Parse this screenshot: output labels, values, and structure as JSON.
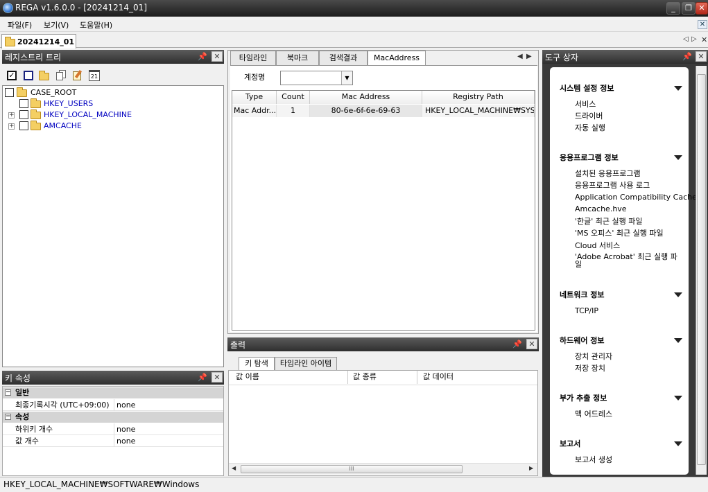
{
  "window": {
    "title": "REGA v1.6.0.0 - [20241214_01]",
    "minimize": "_",
    "restore": "❐",
    "close": "✕"
  },
  "menu": {
    "items": [
      "파일(F)",
      "보기(V)",
      "도움말(H)"
    ],
    "close": "✕"
  },
  "doc_tab": {
    "label": "20241214_01",
    "nav_left": "◁",
    "nav_right": "▷",
    "close": "✕"
  },
  "registry_tree": {
    "title": "레지스트리 트리",
    "toolbar_icons": [
      "check-all-icon",
      "uncheck-all-icon",
      "open-folder-icon",
      "copy-icon",
      "edit-icon",
      "calendar-icon"
    ],
    "calendar_num": "21",
    "nodes": [
      {
        "label": "CASE_ROOT"
      },
      {
        "label": "HKEY_USERS"
      },
      {
        "label": "HKEY_LOCAL_MACHINE"
      },
      {
        "label": "AMCACHE"
      }
    ]
  },
  "key_properties": {
    "title": "키 속성",
    "categories": [
      {
        "name": "일반",
        "rows": [
          {
            "name": "최종기록시각 (UTC+09:00)",
            "value": "none"
          }
        ]
      },
      {
        "name": "속성",
        "rows": [
          {
            "name": "하위키 개수",
            "value": "none"
          },
          {
            "name": "값 개수",
            "value": "none"
          }
        ]
      }
    ]
  },
  "main_tabs": {
    "tabs": [
      "타임라인",
      "북마크",
      "검색결과",
      "MacAddress"
    ],
    "active": "MacAddress",
    "nav_left": "◀",
    "nav_right": "▶",
    "account_label": "계정명",
    "account_value": "",
    "columns": [
      "Type",
      "Count",
      "Mac Address",
      "Registry Path"
    ],
    "rows": [
      {
        "type": "Mac Addr...",
        "count": "1",
        "mac": "80-6e-6f-6e-69-63",
        "path": "HKEY_LOCAL_MACHINE₩SYS..."
      }
    ]
  },
  "output": {
    "title": "출력",
    "tabs": [
      "키 탐색",
      "타임라인 아이템"
    ],
    "columns": [
      "값 이름",
      "값 종류",
      "값 데이터"
    ],
    "scroll_grip": "III"
  },
  "toolbox": {
    "title": "도구 상자",
    "sections": [
      {
        "name": "시스템 설정 정보",
        "items": [
          "서비스",
          "드라이버",
          "자동 실행"
        ]
      },
      {
        "name": "응용프로그램 정보",
        "items": [
          "설치된 응용프로그램",
          "응용프로그램 사용 로그",
          "Application Compatibility Cache",
          "Amcache.hve",
          "'한글' 최근 실행 파일",
          "'MS 오피스' 최근 실행 파일",
          "Cloud 서비스",
          "'Adobe Acrobat' 최근 실행 파",
          "일"
        ]
      },
      {
        "name": "네트워크 정보",
        "items": [
          "TCP/IP"
        ]
      },
      {
        "name": "하드웨어 정보",
        "items": [
          "장치 관리자",
          "저장 장치"
        ]
      },
      {
        "name": "부가 추출 정보",
        "items": [
          "맥 어드레스"
        ]
      },
      {
        "name": "보고서",
        "items": [
          "보고서 생성"
        ]
      }
    ]
  },
  "status_bar": {
    "path": "HKEY_LOCAL_MACHINE₩SOFTWARE₩Windows"
  }
}
